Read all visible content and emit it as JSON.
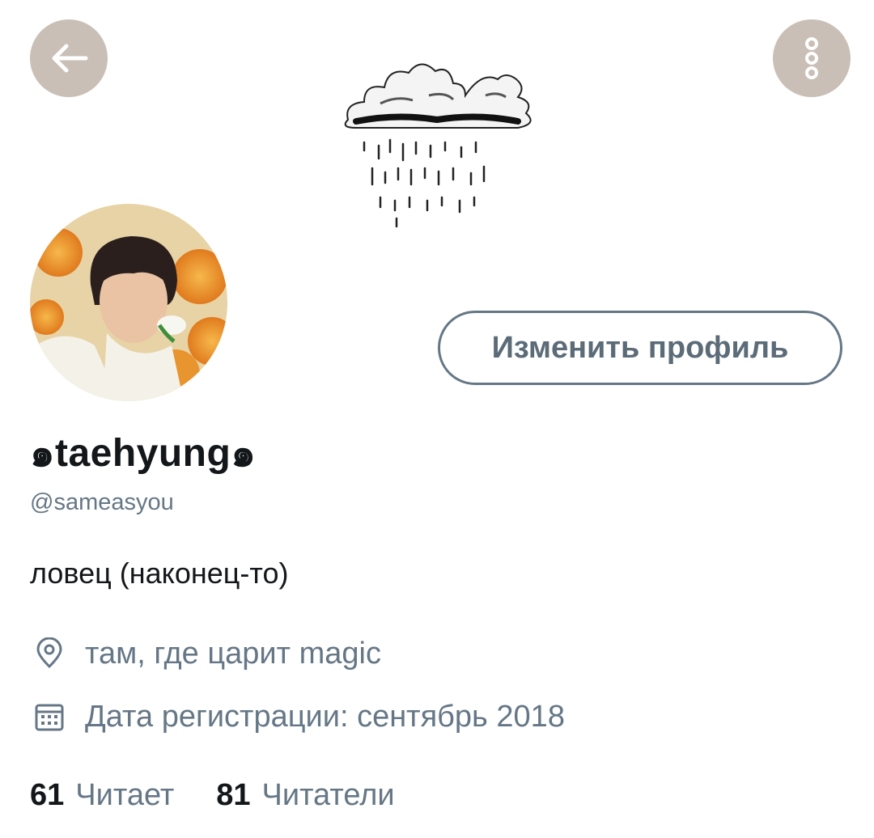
{
  "header": {
    "back_icon": "arrow-left-icon",
    "more_icon": "vertical-ellipsis-icon",
    "art": "rain-cloud-sketch",
    "button_color": "#c9bfb6"
  },
  "profile": {
    "display_name": "๑taehyung๑",
    "handle": "@sameasyou",
    "bio": "ловец (наконец-то)",
    "edit_button_label": "Изменить профиль",
    "location_icon": "location-pin-icon",
    "location": "там, где царит magic",
    "joined_icon": "calendar-icon",
    "joined": "Дата регистрации: сентябрь 2018"
  },
  "stats": {
    "following_count": "61",
    "following_label": "Читает",
    "followers_count": "81",
    "followers_label": "Читатели"
  },
  "colors": {
    "muted_text": "#657786",
    "primary_text": "#14171a"
  }
}
